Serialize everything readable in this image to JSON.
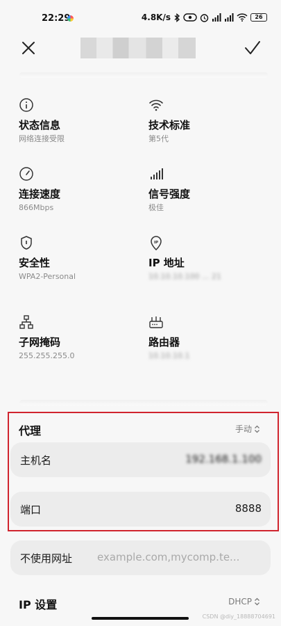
{
  "status": {
    "time": "22:29",
    "net_speed": "4.8K/s",
    "battery": "26"
  },
  "header": {
    "ssid": "██████████"
  },
  "info": [
    {
      "id": "status",
      "icon": "info-icon",
      "label": "状态信息",
      "value": "网络连接受限"
    },
    {
      "id": "standard",
      "icon": "wifi-icon",
      "label": "技术标准",
      "value": "第5代"
    },
    {
      "id": "speed",
      "icon": "speedometer-icon",
      "label": "连接速度",
      "value": "866Mbps"
    },
    {
      "id": "signal",
      "icon": "signal-bars-icon",
      "label": "信号强度",
      "value": "极佳"
    },
    {
      "id": "security",
      "icon": "shield-icon",
      "label": "安全性",
      "value": "WPA2-Personal"
    },
    {
      "id": "ip",
      "icon": "ip-pin-icon",
      "label": "IP 地址",
      "value": "10.10.10.100 ... 21"
    },
    {
      "id": "subnet",
      "icon": "network-tree-icon",
      "label": "子网掩码",
      "value": "255.255.255.0"
    },
    {
      "id": "router",
      "icon": "router-icon",
      "label": "路由器",
      "value": "10.10.10.1"
    }
  ],
  "proxy": {
    "label": "代理",
    "mode": "手动",
    "host_label": "主机名",
    "host_value": "192.168.1.100",
    "port_label": "端口",
    "port_value": "8888",
    "bypass_label": "不使用网址",
    "bypass_placeholder": "example.com,mycomp.te..."
  },
  "ip_settings": {
    "label": "IP 设置",
    "mode": "DHCP"
  },
  "watermark": "CSDN @diy_18888704691"
}
